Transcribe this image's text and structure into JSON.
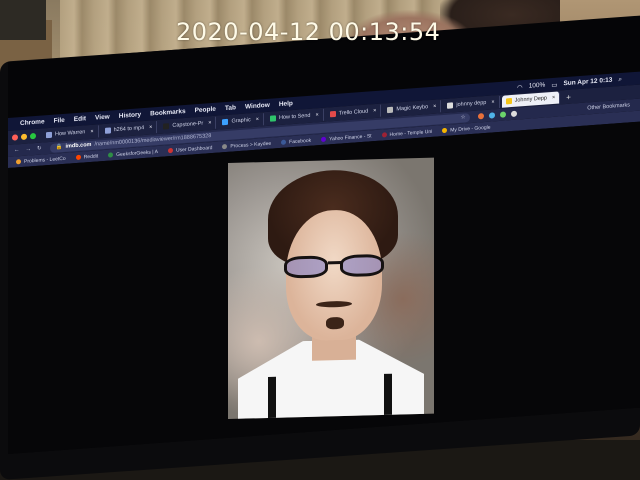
{
  "overlay": {
    "timestamp": "2020-04-12  00:13:54"
  },
  "menubar": {
    "app": "Chrome",
    "items": [
      "File",
      "Edit",
      "View",
      "History",
      "Bookmarks",
      "People",
      "Tab",
      "Window",
      "Help"
    ],
    "battery": "100%",
    "clock": "Sun Apr 12  0:13"
  },
  "tabs": [
    {
      "label": "How Warren",
      "active": false
    },
    {
      "label": "h264 to mp4",
      "active": false
    },
    {
      "label": "Capstone-Pr",
      "active": false
    },
    {
      "label": "Graphic",
      "active": false
    },
    {
      "label": "How to Send",
      "active": false
    },
    {
      "label": "Trello Cloud",
      "active": false
    },
    {
      "label": "Magic Keybo",
      "active": false
    },
    {
      "label": "johnny depp",
      "active": false
    },
    {
      "label": "Johnny Depp",
      "active": true
    }
  ],
  "address": {
    "domain": "imdb.com",
    "path": "/name/nm0000136/mediaviewer/rm1888675328"
  },
  "toolbar": {
    "other_bookmarks": "Other Bookmarks"
  },
  "bookmarks": [
    "Problems - LeetCo",
    "Reddit",
    "GeeksforGeeks | A",
    "User Dashboard",
    "Process > Kaydee",
    "Facebook",
    "Yahoo Finance - St",
    "Home - Temple Uni",
    "My Drive - Google"
  ],
  "colors": {
    "menubar_bg": "#101637",
    "tabbar_bg": "#1c2140",
    "timestamp": "#fffbe8"
  },
  "icons": [
    "apple-icon",
    "wifi-icon",
    "battery-icon",
    "search-icon",
    "back-icon",
    "forward-icon",
    "reload-icon",
    "lock-icon",
    "star-icon",
    "new-tab-icon",
    "close-icon"
  ]
}
